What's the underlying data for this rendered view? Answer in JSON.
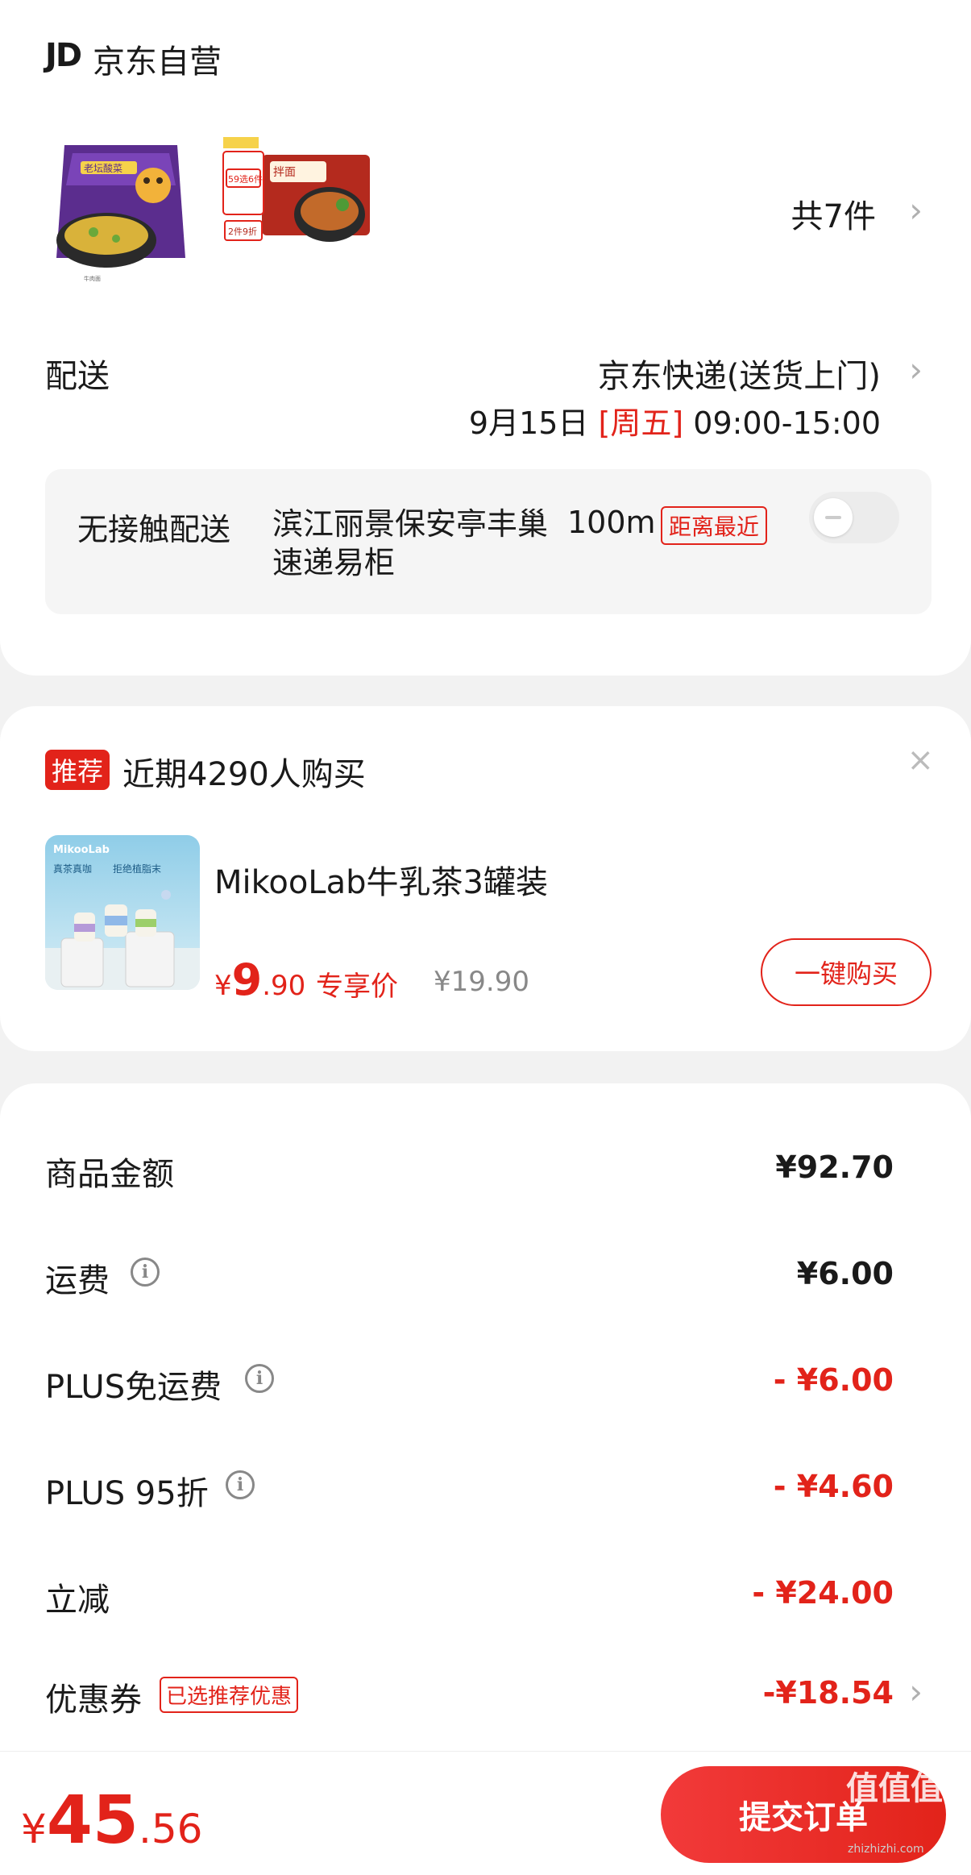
{
  "store": {
    "logo": "JD",
    "name": "京东自营"
  },
  "products": {
    "count": "共7件",
    "thumb1": {
      "brand_text": "老坛酸菜",
      "sub": "牛肉面"
    },
    "thumb2": {
      "brand_text": "拌面",
      "promo1": "59选6件",
      "promo2": "2件9折"
    }
  },
  "shipping": {
    "label": "配送",
    "method": "京东快递(送货上门)",
    "date": "9月15日",
    "weekday": "[周五]",
    "time": "09:00-15:00",
    "contactless": {
      "label": "无接触配送",
      "address": "滨江丽景保安亭丰巢速递易柜",
      "distance": "100m",
      "badge": "距离最近"
    }
  },
  "recommend": {
    "badge": "推荐",
    "title": "近期4290人购买",
    "close": "×",
    "image_brand": "MikooLab",
    "image_tag1": "真茶真咖",
    "image_tag2": "拒绝植脂末",
    "name": "MikooLab牛乳茶3罐装",
    "price_currency": "¥",
    "price_int": "9",
    "price_dec": ".90",
    "exclusive": "专享价",
    "original_price": "¥19.90",
    "buy_label": "一键购买"
  },
  "summary": {
    "goods": {
      "label": "商品金额",
      "value": "¥92.70"
    },
    "freight": {
      "label": "运费",
      "value": "¥6.00"
    },
    "plus_freight": {
      "label": "PLUS免运费",
      "value": "- ¥6.00"
    },
    "plus_discount": {
      "label": "PLUS 95折",
      "value": "- ¥4.60"
    },
    "instant": {
      "label": "立减",
      "value": "- ¥24.00"
    },
    "coupon": {
      "label": "优惠券",
      "tag": "已选推荐优惠",
      "value": "-¥18.54"
    }
  },
  "footer": {
    "currency": "¥",
    "total_int": "45",
    "total_dec": ".56",
    "submit_label": "提交订单",
    "watermark": "值值值",
    "watermark_url": "zhizhizhi.com"
  },
  "colors": {
    "accent": "#e2231a",
    "background": "#f2f2f2"
  }
}
